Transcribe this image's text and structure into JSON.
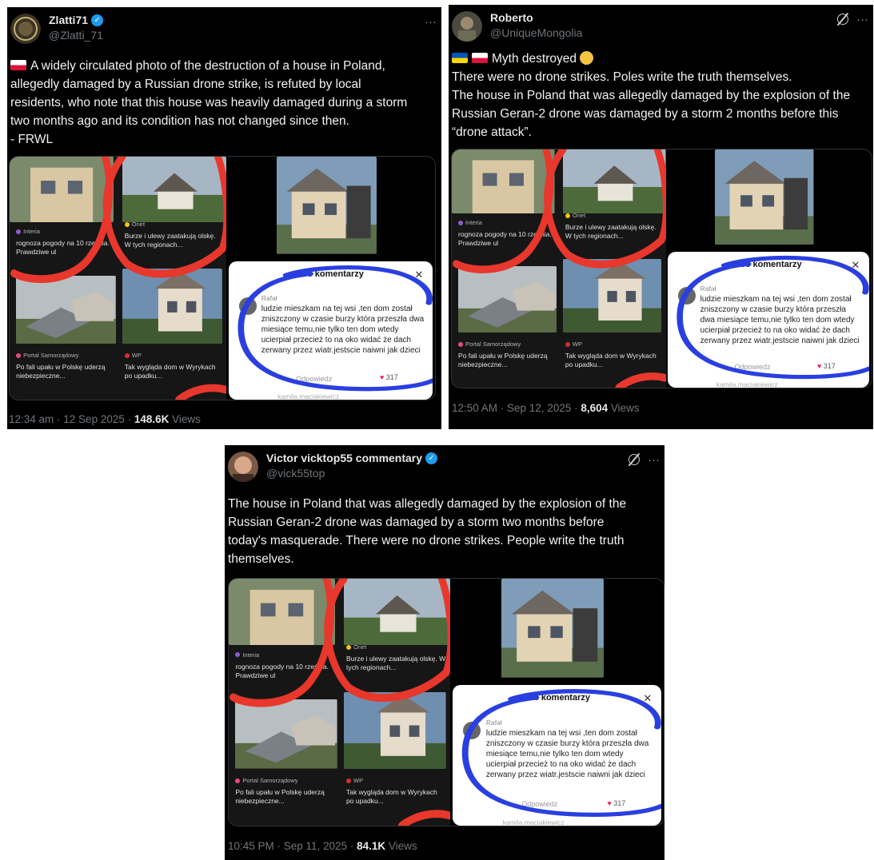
{
  "tweets": [
    {
      "display_name": "Zlatti71",
      "handle": "@Zlatti_71",
      "body_lines": [
        "A widely circulated photo of the destruction of a house in Poland,",
        "allegedly damaged by a Russian drone strike, is refuted by local",
        "residents, who note that this house was heavily damaged during a storm",
        "two months ago and its condition has not changed since then.",
        "- FRWL"
      ],
      "time": "12:34 am · 12 Sep 2025 · ",
      "views_count": "148.6K",
      "views_label": " Views"
    },
    {
      "display_name": "Roberto",
      "handle": "@UniqueMongolia",
      "body_lines": [
        "Myth destroyed",
        "There were no drone strikes. Poles write the truth themselves.",
        "The house in Poland that was allegedly damaged by the explosion of the",
        "Russian Geran-2 drone was damaged by a storm 2 months before this",
        "“drone attack”."
      ],
      "time": "12:50 AM · Sep 12, 2025 · ",
      "views_count": "8,604",
      "views_label": " Views"
    },
    {
      "display_name": "Victor vicktop55 commentary",
      "handle": "@vick55top",
      "body_lines": [
        "The house in Poland that was allegedly damaged by the explosion of the",
        "Russian Geran-2 drone was damaged by a storm two months before",
        "today's masquerade. There were no drone strikes. People write the truth",
        "themselves."
      ],
      "time": "10:45 PM · Sep 11, 2025 · ",
      "views_count": "84.1K",
      "views_label": " Views"
    }
  ],
  "media": {
    "card1_source": "Interia",
    "card1_title": "rognoza pogody na 10 rześnia. Prawdziwe ul",
    "card2_source": "Onet",
    "card2_title": "Burze i ulewy zaatakują olskę. W tych regionach...",
    "card3_source": "Portal Samorządowy",
    "card3_title": "Po fali upału w Polskę uderzą niebezpieczne...",
    "card4_source": "WP",
    "card4_title": "Tak wygląda dom w Wyrykach po upadku...",
    "comments_title": "208 komentarzy",
    "close": "✕",
    "commenter": "Rafał",
    "comment_text": "ludzie mieszkam na tej wsi ,ten dom został zniszczony w czasie burzy która przeszła dwa miesiące temu,nie tylko ten dom wtedy ucierpiał przecież to na oko widać że dach zerwany przez wiatr.jestscie naiwni jak dzieci",
    "reply": "Odpowiedz",
    "likes": "317",
    "next_user": "kamila.maciakiewicz"
  },
  "icons": {
    "more": "···",
    "verified": "✓",
    "heart": "♥",
    "dislike": "👎"
  },
  "colors": {
    "tweet_bg": "#000000",
    "verified": "#1d9bf0",
    "red_scribble": "#e8372c",
    "blue_scribble": "#2a3fe0"
  }
}
